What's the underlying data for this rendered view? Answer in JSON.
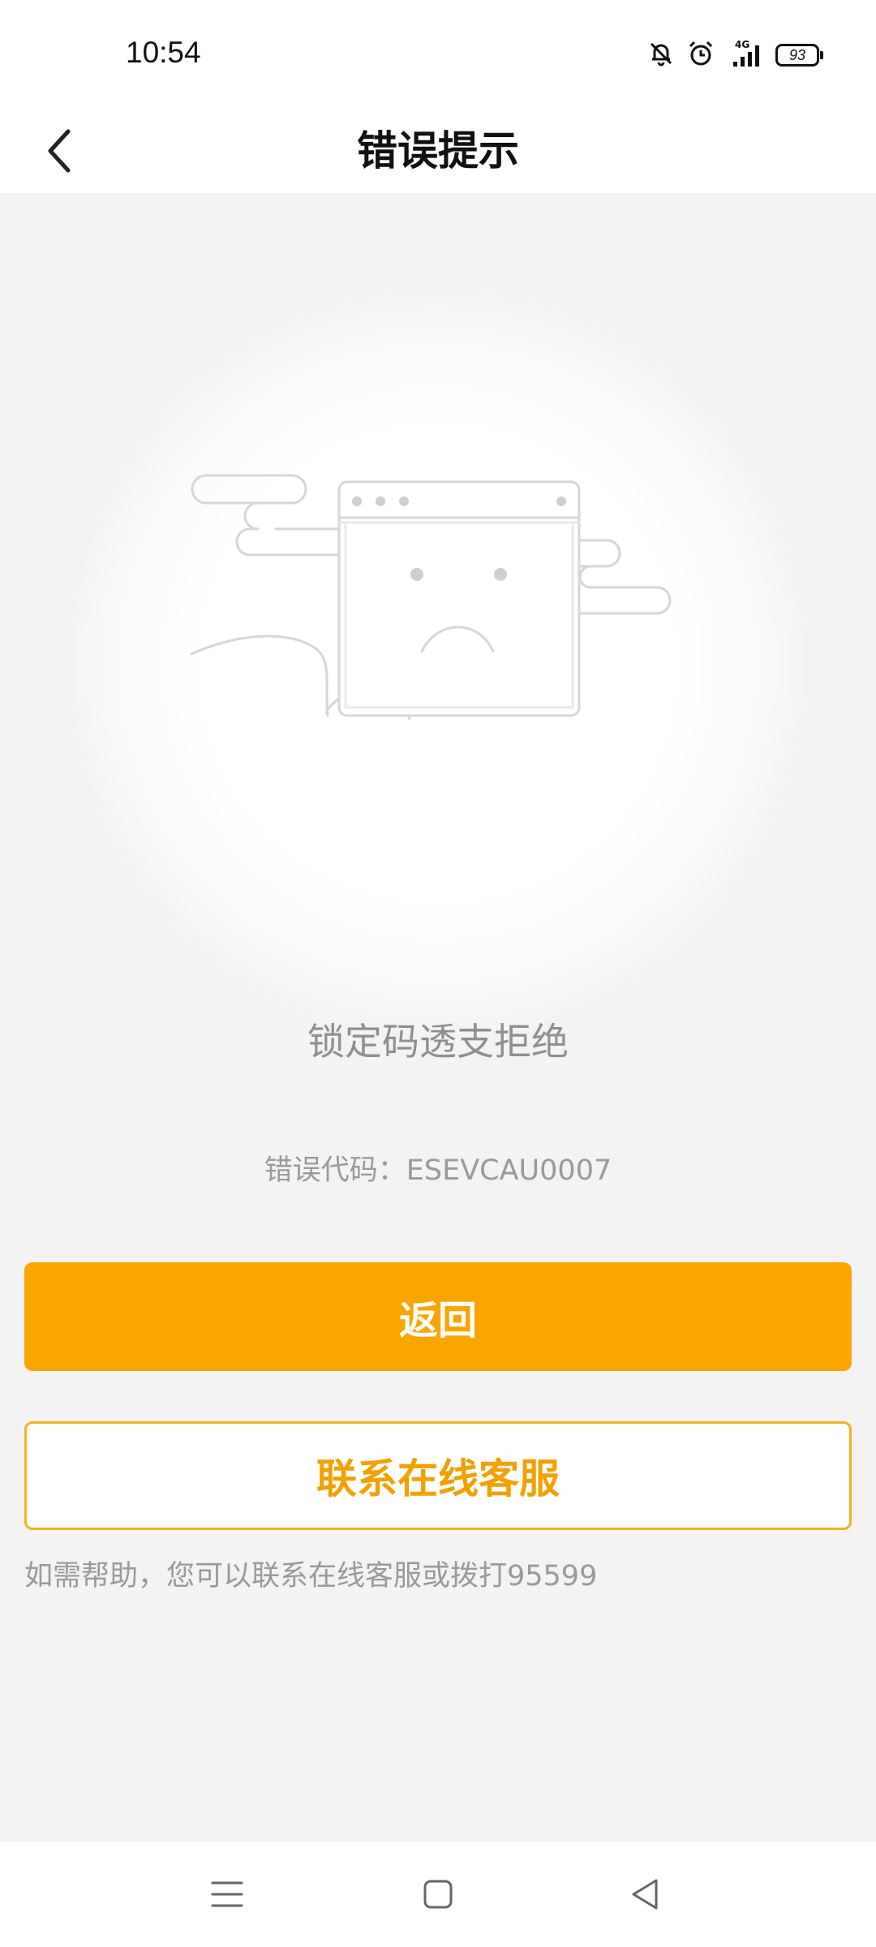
{
  "status_bar": {
    "time": "10:54",
    "network": "4G",
    "battery": "93",
    "icons": [
      "bell-mute-icon",
      "alarm-icon",
      "signal-icon",
      "battery-icon"
    ]
  },
  "header": {
    "title": "错误提示",
    "back_icon": "chevron-left-icon"
  },
  "main": {
    "illustration": "sad-browser-window-icon",
    "message": "锁定码透支拒绝",
    "error_code": "错误代码：ESEVCAU0007",
    "return_label": "返回",
    "support_label": "联系在线客服",
    "help_text": "如需帮助，您可以联系在线客服或拨打95599"
  },
  "colors": {
    "primary": "#fba600",
    "outline": "#f2b21b",
    "text_muted": "#9a9a9a"
  },
  "system_nav": {
    "icons": [
      "menu-icon",
      "home-icon",
      "back-triangle-icon"
    ]
  }
}
